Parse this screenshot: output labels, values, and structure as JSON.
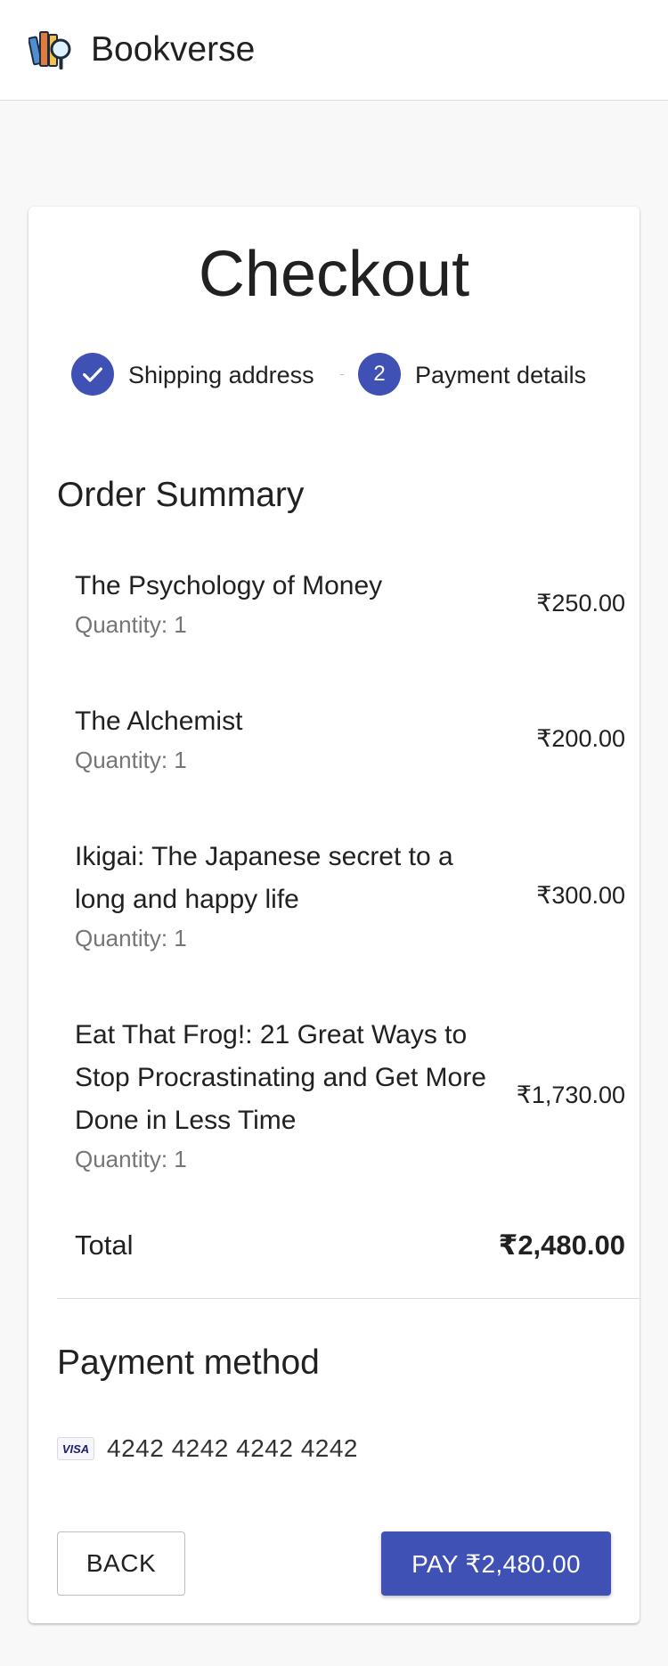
{
  "app": {
    "brand": "Bookverse"
  },
  "checkout": {
    "title": "Checkout",
    "steps": [
      {
        "label": "Shipping address",
        "status": "completed",
        "icon": "check-icon"
      },
      {
        "number": "2",
        "label": "Payment details",
        "status": "active"
      }
    ]
  },
  "order_summary": {
    "title": "Order Summary",
    "items": [
      {
        "name": "The Psychology of Money",
        "quantity": "Quantity: 1",
        "price": "₹250.00"
      },
      {
        "name": "The Alchemist",
        "quantity": "Quantity: 1",
        "price": "₹200.00"
      },
      {
        "name": "Ikigai: The Japanese secret to a long and happy life",
        "quantity": "Quantity: 1",
        "price": "₹300.00"
      },
      {
        "name": "Eat That Frog!: 21 Great Ways to Stop Procrastinating and Get More Done in Less Time",
        "quantity": "Quantity: 1",
        "price": "₹1,730.00"
      }
    ],
    "total_label": "Total",
    "total_value": "₹2,480.00"
  },
  "payment": {
    "title": "Payment method",
    "card_brand": "VISA",
    "card_number": "4242 4242 4242 4242"
  },
  "actions": {
    "back_label": "BACK",
    "pay_label": "PAY ₹2,480.00"
  },
  "colors": {
    "primary": "#3f51b5",
    "background": "#f8f8f8",
    "card": "#ffffff",
    "secondary_text": "#757575"
  }
}
